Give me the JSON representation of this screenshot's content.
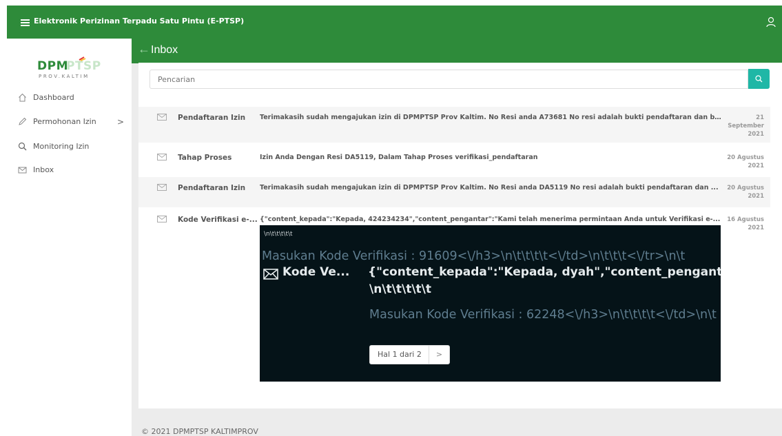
{
  "header": {
    "app_title": "Elektronik Perizinan Terpadu Satu Pintu (E-PTSP)"
  },
  "logo": {
    "line1": "DPMPTSP",
    "line2": "PROV.KALTIM"
  },
  "sidebar": {
    "items": [
      {
        "label": "Dashboard",
        "icon": "home-icon"
      },
      {
        "label": "Permohonan Izin",
        "icon": "pencil-icon",
        "chevron": ">"
      },
      {
        "label": "Monitoring Izin",
        "icon": "search-icon"
      },
      {
        "label": "Inbox",
        "icon": "envelope-icon"
      }
    ]
  },
  "page": {
    "title": "Inbox"
  },
  "search": {
    "placeholder": "Pencarian"
  },
  "inbox": [
    {
      "subject": "Pendaftaran Izin",
      "message": "Terimakasih sudah mengajukan izin di DPMPTSP Prov Kaltim. No Resi anda A73681 No resi adalah bukti pendaftaran dan b...",
      "date_line1": "21",
      "date_line2": "September",
      "date_line3": "2021"
    },
    {
      "subject": "Tahap Proses",
      "message": "Izin Anda Dengan Resi DA5119, Dalam Tahap Proses verifikasi_pendaftaran",
      "date_line1": "20 Agustus",
      "date_line2": "2021"
    },
    {
      "subject": "Pendaftaran Izin",
      "message": "Terimakasih sudah mengajukan izin di DPMPTSP Prov Kaltim. No Resi anda DA5119 No resi adalah bukti pendaftaran dan ...",
      "date_line1": "20 Agustus",
      "date_line2": "2021"
    },
    {
      "subject": "Kode Verifikasi e-...",
      "message": "{\"content_kepada\":\"Kepada, 424234234\",\"content_pengantar\":\"Kami telah menerima permintaan Anda untuk Verifikasi e-...",
      "date_line1": "16 Agustus",
      "date_line2": "2021"
    }
  ],
  "embedded": {
    "line1": "\\n\\t\\t\\t\\t\\t",
    "line2": "Masukan Kode Verifikasi : 91609<\\/h3>\\n\\t\\t\\t\\t<\\/td>\\n\\t\\t\\t<\\/tr>\\n\\t",
    "subject": "Kode Ve...",
    "message": "{\"content_kepada\":\"Kepada, dyah\",\"content_pengantar\":\"Kami",
    "line3": "\\n\\t\\t\\t\\t\\t",
    "line4": "Masukan Kode Verifikasi : 62248<\\/h3>\\n\\t\\t\\t\\t<\\/td>\\n\\t",
    "pager_label": "Hal 1 dari 2",
    "pager_next": ">"
  },
  "footer": {
    "text": "© 2021 DPMPTSP KALTIMPROV"
  },
  "colors": {
    "brand_green": "#2e8b3a",
    "search_teal": "#1fb7a6",
    "embed_bg": "#051318"
  }
}
